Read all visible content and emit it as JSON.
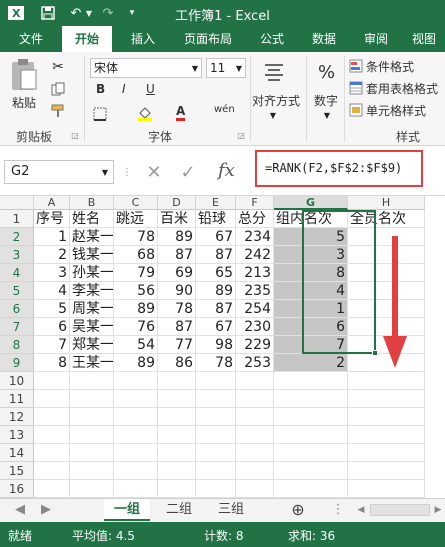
{
  "window": {
    "title": "工作簿1 - Excel"
  },
  "tabs": [
    "文件",
    "开始",
    "插入",
    "页面布局",
    "公式",
    "数据",
    "审阅",
    "视图"
  ],
  "active_tab": 1,
  "ribbon": {
    "clipboard": {
      "paste_label": "粘贴",
      "group_label": "剪贴板"
    },
    "font": {
      "name": "宋体",
      "size": "11",
      "group_label": "字体",
      "bold": "B",
      "italic": "I",
      "underline": "U",
      "font_color_glyph": "A",
      "phonetic": "wén"
    },
    "alignment": {
      "label": "对齐方式"
    },
    "number": {
      "label": "数字",
      "icon_glyph": "%"
    },
    "styles": {
      "items": [
        "条件格式",
        "套用表格格式",
        "单元格样式"
      ],
      "group_label": "样式"
    }
  },
  "formula_bar": {
    "name_box": "G2",
    "fx_glyph": "fx",
    "formula": "=RANK(F2,$F$2:$F$9)"
  },
  "grid": {
    "columns": [
      "A",
      "B",
      "C",
      "D",
      "E",
      "F",
      "G",
      "H"
    ],
    "selected_column": "G",
    "row_numbers": [
      "1",
      "2",
      "3",
      "4",
      "5",
      "6",
      "7",
      "8",
      "9",
      "10",
      "11",
      "12",
      "13",
      "14",
      "15",
      "16"
    ],
    "headers": [
      "序号",
      "姓名",
      "跳远",
      "百米",
      "铅球",
      "总分",
      "组内名次",
      "全员名次"
    ],
    "rows": [
      [
        "1",
        "赵某一",
        "78",
        "89",
        "67",
        "234",
        "5"
      ],
      [
        "2",
        "钱某一",
        "68",
        "87",
        "87",
        "242",
        "3"
      ],
      [
        "3",
        "孙某一",
        "79",
        "69",
        "65",
        "213",
        "8"
      ],
      [
        "4",
        "李某一",
        "56",
        "90",
        "89",
        "235",
        "4"
      ],
      [
        "5",
        "周某一",
        "89",
        "78",
        "87",
        "254",
        "1"
      ],
      [
        "6",
        "吴某一",
        "76",
        "87",
        "67",
        "230",
        "6"
      ],
      [
        "7",
        "郑某一",
        "54",
        "77",
        "98",
        "229",
        "7"
      ],
      [
        "8",
        "王某一",
        "89",
        "86",
        "78",
        "253",
        "2"
      ]
    ]
  },
  "sheets": [
    "一组",
    "二组",
    "三组"
  ],
  "active_sheet": 0,
  "status": {
    "ready": "就绪",
    "average": "平均值: 4.5",
    "count": "计数: 8",
    "sum": "求和: 36"
  },
  "colors": {
    "brand": "#217346",
    "highlight": "#e04040",
    "selection": "#c6c6c6"
  }
}
